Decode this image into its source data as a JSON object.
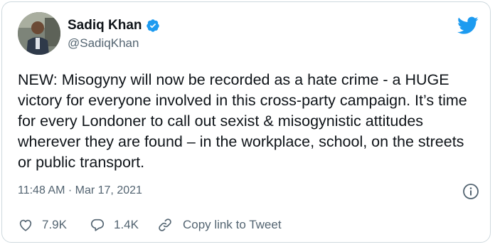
{
  "author": {
    "name": "Sadiq Khan",
    "handle": "@SadiqKhan",
    "verified": true
  },
  "tweet": {
    "text": "NEW: Misogyny will now be recorded as a hate crime - a HUGE victory for everyone involved in this cross-party campaign. It’s time for every Londoner to call out sexist & misogynistic attitudes wherever they are found – in the workplace, school, on the streets or public transport.",
    "timestamp": "11:48 AM · Mar 17, 2021"
  },
  "actions": {
    "likes": "7.9K",
    "replies": "1.4K",
    "copy_link": "Copy link to Tweet"
  },
  "icons": {
    "brand": "twitter-bird-icon",
    "verified": "verified-badge-icon",
    "info": "info-icon",
    "like": "heart-icon",
    "reply": "reply-bubble-icon",
    "copy": "link-icon"
  },
  "colors": {
    "brand_blue": "#1d9bf0",
    "text_primary": "#0f1419",
    "text_secondary": "#536471",
    "border": "#cfd9de"
  }
}
